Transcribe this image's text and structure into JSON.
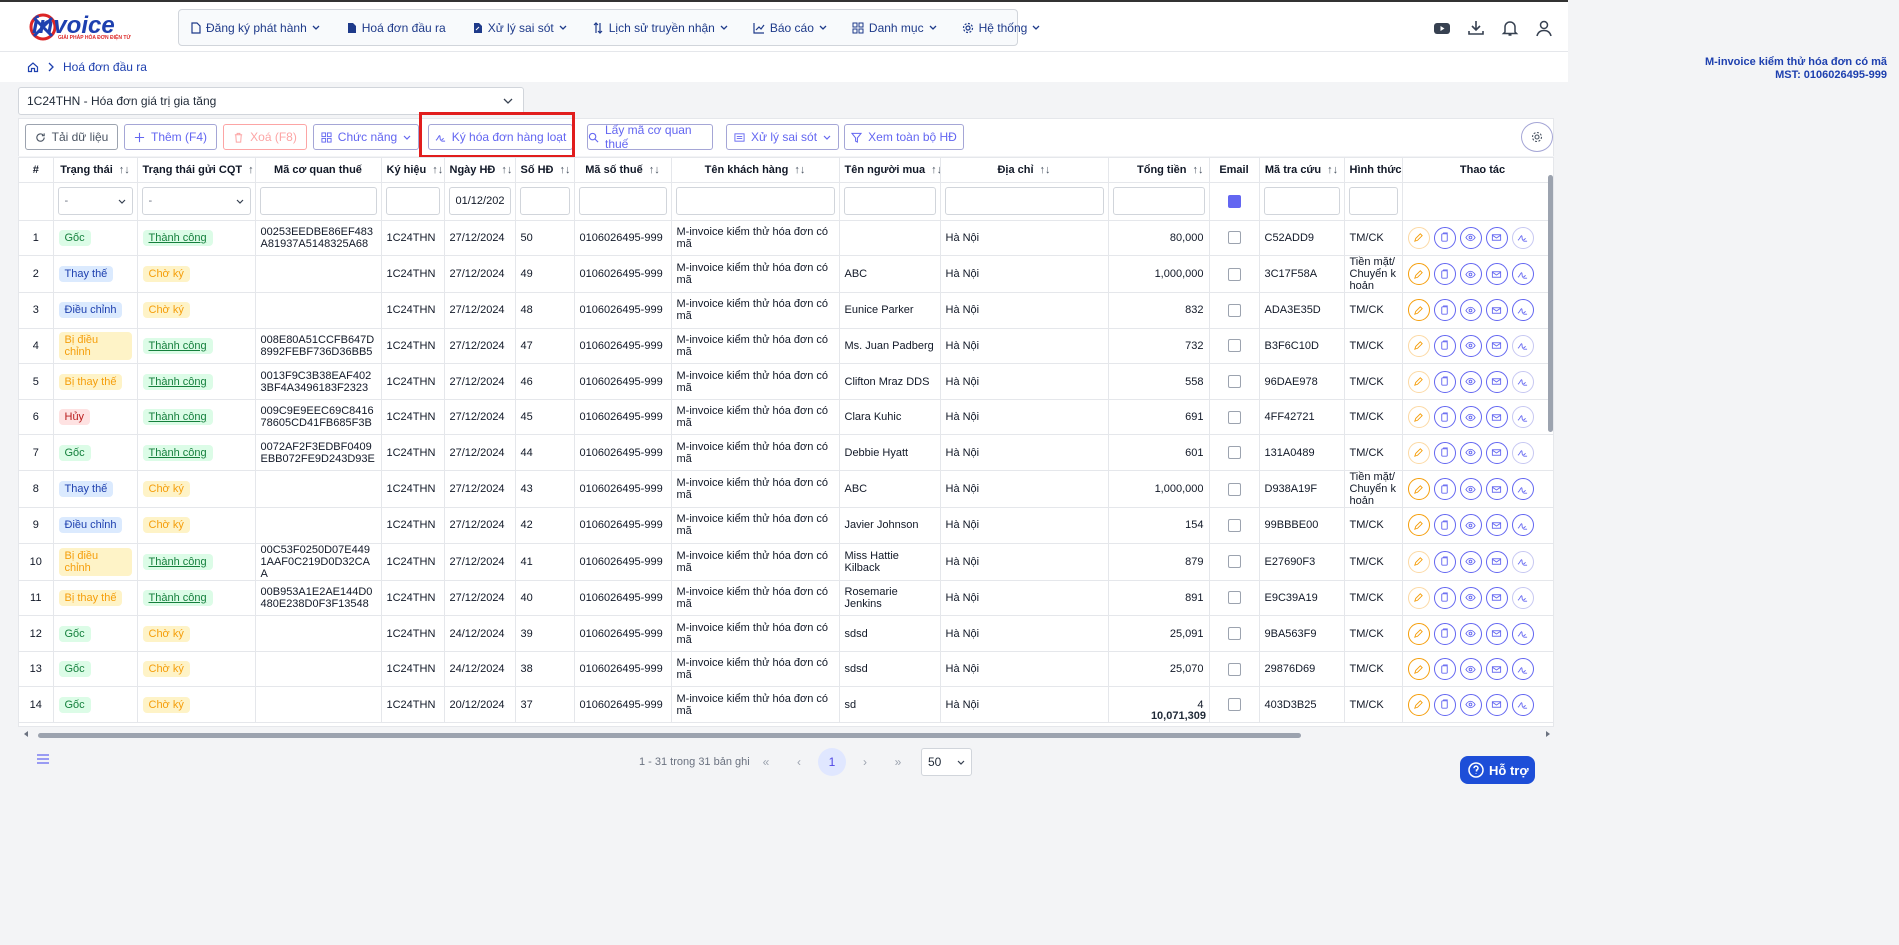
{
  "app": {
    "logo_text": "invoice",
    "logo_sub": "GIẢI PHÁP HÓA ĐƠN ĐIỆN TỬ"
  },
  "nav": [
    {
      "label": "Đăng ký phát hành",
      "icon": "file-icon",
      "dropdown": true
    },
    {
      "label": "Hoá đơn đầu ra",
      "icon": "document-icon",
      "dropdown": false
    },
    {
      "label": "Xử lý sai sót",
      "icon": "file-edit-icon",
      "dropdown": true
    },
    {
      "label": "Lịch sử truyền nhận",
      "icon": "arrows-icon",
      "dropdown": true
    },
    {
      "label": "Báo cáo",
      "icon": "chart-icon",
      "dropdown": true
    },
    {
      "label": "Danh mục",
      "icon": "grid-icon",
      "dropdown": true
    },
    {
      "label": "Hệ thống",
      "icon": "gear-icon",
      "dropdown": true
    }
  ],
  "breadcrumb": {
    "current": "Hoá đơn đầu ra"
  },
  "company": {
    "name": "M-invoice kiểm thử hóa đơn có mã",
    "tax_id": "MST: 0106026495-999"
  },
  "series_select": {
    "value": "1C24THN - Hóa đơn giá trị gia tăng"
  },
  "toolbar": {
    "reload": "Tải dữ liệu",
    "add": "Thêm (F4)",
    "delete": "Xoá (F8)",
    "functions": "Chức năng",
    "batch_sign": "Ký hóa đơn hàng loạt",
    "get_tax_code": "Lấy mã cơ quan thuế",
    "handle_errors": "Xử lý sai sót",
    "view_all": "Xem toàn bộ HĐ"
  },
  "table": {
    "headers": [
      "#",
      "Trạng thái",
      "Trạng thái gửi CQT",
      "Mã cơ quan thuế",
      "Ký hiệu",
      "Ngày HĐ",
      "Số HĐ",
      "Mã số thuế",
      "Tên khách hàng",
      "Tên người mua",
      "Địa chỉ",
      "Tổng tiền",
      "Email",
      "Mã tra cứu",
      "Hình thức",
      "Thao tác"
    ],
    "filters": {
      "status": "-",
      "send_status": "-",
      "date": "01/12/202"
    },
    "rows": [
      {
        "no": "1",
        "status": "Gốc",
        "st": "goc",
        "send": "Thành công",
        "sd": "ok",
        "tax_code": "00253EEDBE86EF483A81937A5148325A68",
        "sym": "1C24THN",
        "date": "27/12/2024",
        "num": "50",
        "mst": "0106026495-999",
        "customer": "M-invoice kiểm thử hóa đơn có mã",
        "buyer": "",
        "addr": "Hà Nội",
        "total": "80,000",
        "code": "C52ADD9",
        "form": "TM/CK",
        "dim": true
      },
      {
        "no": "2",
        "status": "Thay thế",
        "st": "thaythe",
        "send": "Chờ ký",
        "sd": "wait",
        "tax_code": "",
        "sym": "1C24THN",
        "date": "27/12/2024",
        "num": "49",
        "mst": "0106026495-999",
        "customer": "M-invoice kiểm thử hóa đơn có mã",
        "buyer": "ABC",
        "addr": "Hà Nội",
        "total": "1,000,000",
        "code": "3C17F58A",
        "form": "Tiền mặt/Chuyển khoản",
        "dim": false
      },
      {
        "no": "3",
        "status": "Điều chỉnh",
        "st": "dieuchinh",
        "send": "Chờ ký",
        "sd": "wait",
        "tax_code": "",
        "sym": "1C24THN",
        "date": "27/12/2024",
        "num": "48",
        "mst": "0106026495-999",
        "customer": "M-invoice kiểm thử hóa đơn có mã",
        "buyer": "Eunice Parker",
        "addr": "Hà Nội",
        "total": "832",
        "code": "ADA3E35D",
        "form": "TM/CK",
        "dim": false
      },
      {
        "no": "4",
        "status": "Bị điều chỉnh",
        "st": "bidc",
        "send": "Thành công",
        "sd": "ok",
        "tax_code": "008E80A51CCFB647D8992FEBF736D36BB5",
        "sym": "1C24THN",
        "date": "27/12/2024",
        "num": "47",
        "mst": "0106026495-999",
        "customer": "M-invoice kiểm thử hóa đơn có mã",
        "buyer": "Ms. Juan Padberg",
        "addr": "Hà Nội",
        "total": "732",
        "code": "B3F6C10D",
        "form": "TM/CK",
        "dim": true
      },
      {
        "no": "5",
        "status": "Bị thay thế",
        "st": "bithaythe",
        "send": "Thành công",
        "sd": "ok",
        "tax_code": "0013F9C3B38EAF4023BF4A3496183F2323",
        "sym": "1C24THN",
        "date": "27/12/2024",
        "num": "46",
        "mst": "0106026495-999",
        "customer": "M-invoice kiểm thử hóa đơn có mã",
        "buyer": "Clifton Mraz DDS",
        "addr": "Hà Nội",
        "total": "558",
        "code": "96DAE978",
        "form": "TM/CK",
        "dim": true
      },
      {
        "no": "6",
        "status": "Hủy",
        "st": "huy",
        "send": "Thành công",
        "sd": "ok",
        "tax_code": "009C9E9EEC69C841678605CD41FB685F3B",
        "sym": "1C24THN",
        "date": "27/12/2024",
        "num": "45",
        "mst": "0106026495-999",
        "customer": "M-invoice kiểm thử hóa đơn có mã",
        "buyer": "Clara Kuhic",
        "addr": "Hà Nội",
        "total": "691",
        "code": "4FF42721",
        "form": "TM/CK",
        "dim": true
      },
      {
        "no": "7",
        "status": "Gốc",
        "st": "goc",
        "send": "Thành công",
        "sd": "ok",
        "tax_code": "0072AF2F3EDBF0409EBB072FE9D243D93E",
        "sym": "1C24THN",
        "date": "27/12/2024",
        "num": "44",
        "mst": "0106026495-999",
        "customer": "M-invoice kiểm thử hóa đơn có mã",
        "buyer": "Debbie Hyatt",
        "addr": "Hà Nội",
        "total": "601",
        "code": "131A0489",
        "form": "TM/CK",
        "dim": true
      },
      {
        "no": "8",
        "status": "Thay thế",
        "st": "thaythe",
        "send": "Chờ ký",
        "sd": "wait",
        "tax_code": "",
        "sym": "1C24THN",
        "date": "27/12/2024",
        "num": "43",
        "mst": "0106026495-999",
        "customer": "M-invoice kiểm thử hóa đơn có mã",
        "buyer": "ABC",
        "addr": "Hà Nội",
        "total": "1,000,000",
        "code": "D938A19F",
        "form": "Tiền mặt/Chuyển khoản",
        "dim": false
      },
      {
        "no": "9",
        "status": "Điều chỉnh",
        "st": "dieuchinh",
        "send": "Chờ ký",
        "sd": "wait",
        "tax_code": "",
        "sym": "1C24THN",
        "date": "27/12/2024",
        "num": "42",
        "mst": "0106026495-999",
        "customer": "M-invoice kiểm thử hóa đơn có mã",
        "buyer": "Javier Johnson",
        "addr": "Hà Nội",
        "total": "154",
        "code": "99BBBE00",
        "form": "TM/CK",
        "dim": false
      },
      {
        "no": "10",
        "status": "Bị điều chỉnh",
        "st": "bidc",
        "send": "Thành công",
        "sd": "ok",
        "tax_code": "00C53F0250D07E4491AAF0C219D0D32CAA",
        "sym": "1C24THN",
        "date": "27/12/2024",
        "num": "41",
        "mst": "0106026495-999",
        "customer": "M-invoice kiểm thử hóa đơn có mã",
        "buyer": "Miss Hattie Kilback",
        "addr": "Hà Nội",
        "total": "879",
        "code": "E27690F3",
        "form": "TM/CK",
        "dim": true
      },
      {
        "no": "11",
        "status": "Bị thay thế",
        "st": "bithaythe",
        "send": "Thành công",
        "sd": "ok",
        "tax_code": "00B953A1E2AE144D0480E238D0F3F13548",
        "sym": "1C24THN",
        "date": "27/12/2024",
        "num": "40",
        "mst": "0106026495-999",
        "customer": "M-invoice kiểm thử hóa đơn có mã",
        "buyer": "Rosemarie Jenkins",
        "addr": "Hà Nội",
        "total": "891",
        "code": "E9C39A19",
        "form": "TM/CK",
        "dim": true
      },
      {
        "no": "12",
        "status": "Gốc",
        "st": "goc",
        "send": "Chờ ký",
        "sd": "wait",
        "tax_code": "",
        "sym": "1C24THN",
        "date": "24/12/2024",
        "num": "39",
        "mst": "0106026495-999",
        "customer": "M-invoice kiểm thử hóa đơn có mã",
        "buyer": "sdsd",
        "addr": "Hà Nội",
        "total": "25,091",
        "code": "9BA563F9",
        "form": "TM/CK",
        "dim": false
      },
      {
        "no": "13",
        "status": "Gốc",
        "st": "goc",
        "send": "Chờ ký",
        "sd": "wait",
        "tax_code": "",
        "sym": "1C24THN",
        "date": "24/12/2024",
        "num": "38",
        "mst": "0106026495-999",
        "customer": "M-invoice kiểm thử hóa đơn có mã",
        "buyer": "sdsd",
        "addr": "Hà Nội",
        "total": "25,070",
        "code": "29876D69",
        "form": "TM/CK",
        "dim": false
      },
      {
        "no": "14",
        "status": "Gốc",
        "st": "goc",
        "send": "Chờ ký",
        "sd": "wait",
        "tax_code": "",
        "sym": "1C24THN",
        "date": "20/12/2024",
        "num": "37",
        "mst": "0106026495-999",
        "customer": "M-invoice kiểm thử hóa đơn có mã",
        "buyer": "sd",
        "addr": "Hà Nội",
        "total": "4",
        "code": "403D3B25",
        "form": "TM/CK",
        "dim": false
      }
    ],
    "sum_total": "10,071,309"
  },
  "pagination": {
    "summary": "1 - 31 trong 31 bản ghi",
    "current": "1",
    "page_size": "50"
  },
  "support": {
    "label": "Hỗ trợ"
  },
  "colors": {
    "accent": "#6366f1",
    "brand": "#1e40af",
    "highlight": "#e11d1d"
  }
}
